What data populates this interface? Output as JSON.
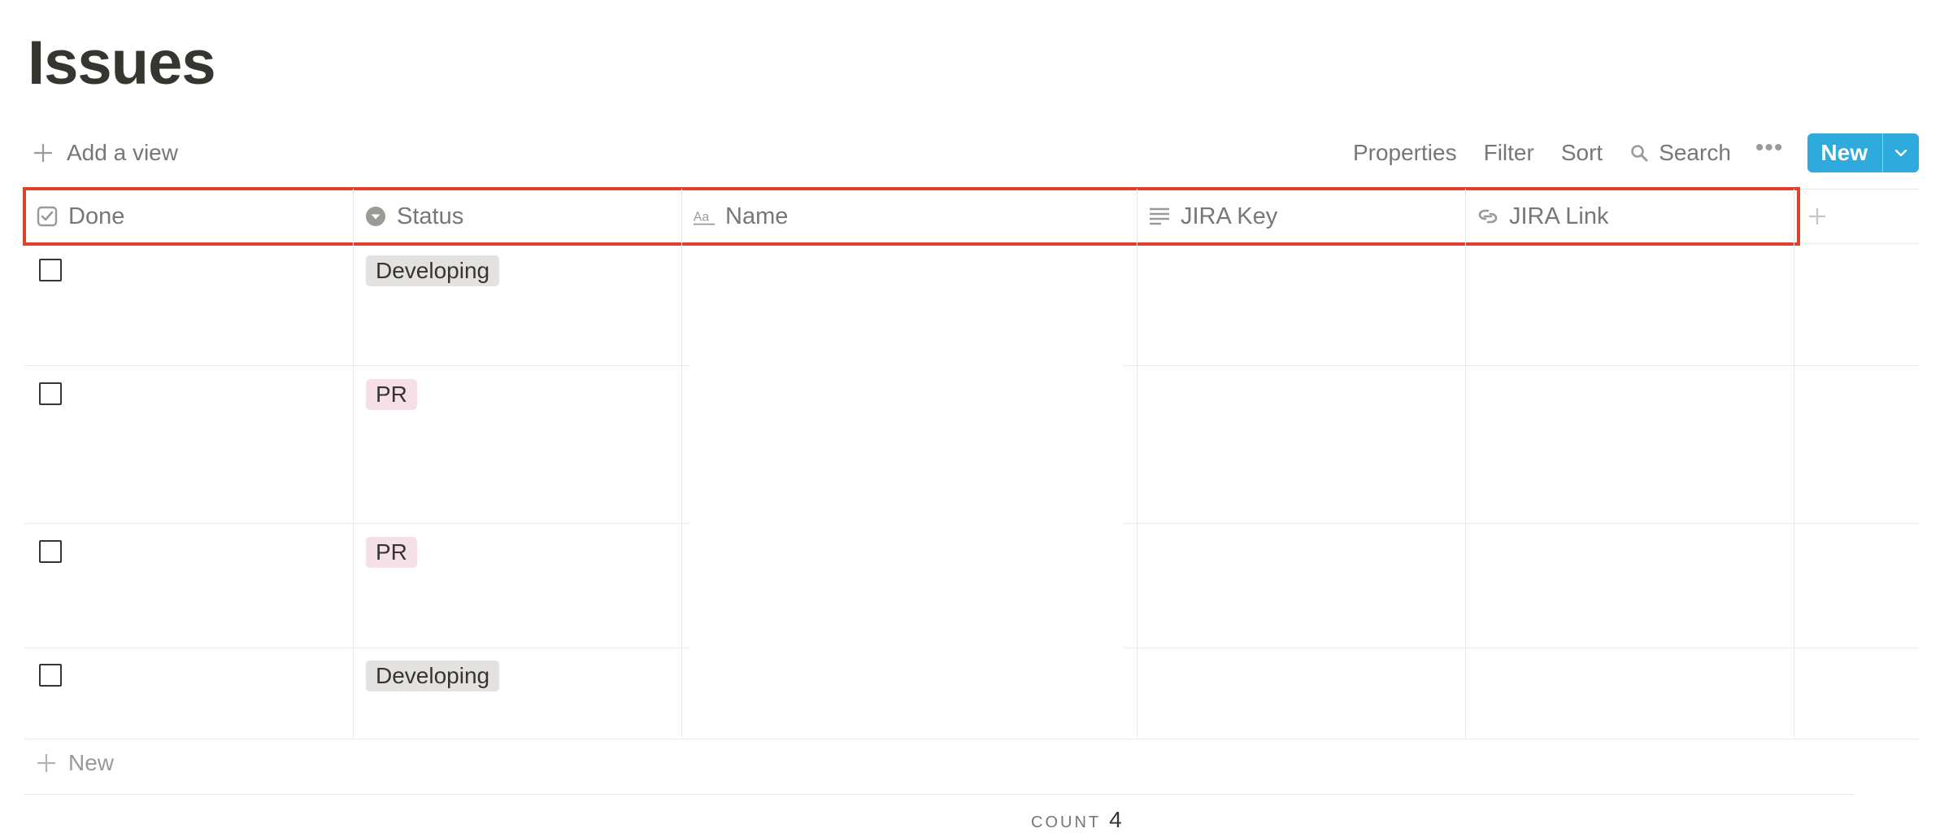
{
  "page": {
    "title": "Issues"
  },
  "toolbar": {
    "add_view": "Add a view",
    "properties": "Properties",
    "filter": "Filter",
    "sort": "Sort",
    "search": "Search",
    "more": "•••",
    "new": "New"
  },
  "table": {
    "columns": [
      {
        "label": "Done",
        "icon": "checkbox-icon"
      },
      {
        "label": "Status",
        "icon": "select-icon"
      },
      {
        "label": "Name",
        "icon": "text-title-icon"
      },
      {
        "label": "JIRA Key",
        "icon": "text-lines-icon"
      },
      {
        "label": "JIRA Link",
        "icon": "link-icon"
      }
    ],
    "rows": [
      {
        "done": false,
        "status": "Developing",
        "status_color": "#e3e2e0",
        "name": "",
        "jira_key": "",
        "jira_link": ""
      },
      {
        "done": false,
        "status": "PR",
        "status_color": "#f5e0e9",
        "name": "",
        "jira_key": "",
        "jira_link": ""
      },
      {
        "done": false,
        "status": "PR",
        "status_color": "#f5e0e9",
        "name": "",
        "jira_key": "",
        "jira_link": ""
      },
      {
        "done": false,
        "status": "Developing",
        "status_color": "#e3e2e0",
        "name": "",
        "jira_key": "",
        "jira_link": ""
      }
    ],
    "add_row": "New",
    "count_label": "COUNT",
    "count_value": "4"
  },
  "colors": {
    "accent": "#2eaadc",
    "highlight": "#e0402c"
  }
}
